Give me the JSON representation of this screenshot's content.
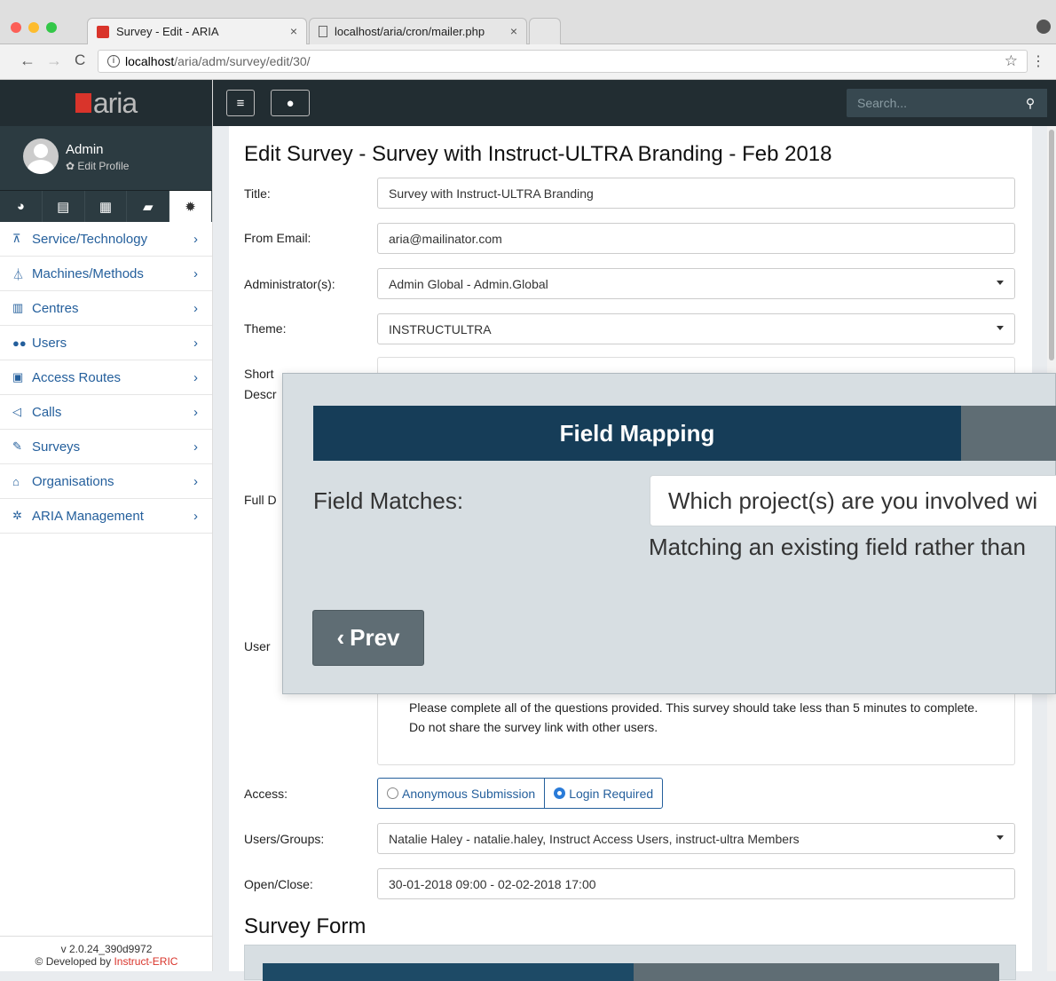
{
  "browser": {
    "tabs": [
      {
        "label": "Survey - Edit - ARIA"
      },
      {
        "label": "localhost/aria/cron/mailer.php"
      }
    ],
    "url_host": "localhost",
    "url_path": "/aria/adm/survey/edit/30/"
  },
  "app": {
    "logo": "aria",
    "user_name": "Admin",
    "edit_profile": "Edit Profile",
    "search_placeholder": "Search...",
    "version": "v 2.0.24_390d9972",
    "developed_by_prefix": "© Developed by ",
    "developed_by_link": "Instruct-ERIC"
  },
  "sidebar": {
    "items": [
      {
        "label": "Service/Technology",
        "icon": "sitemap-icon"
      },
      {
        "label": "Machines/Methods",
        "icon": "flask-icon"
      },
      {
        "label": "Centres",
        "icon": "building-icon"
      },
      {
        "label": "Users",
        "icon": "users-icon"
      },
      {
        "label": "Access Routes",
        "icon": "money-icon"
      },
      {
        "label": "Calls",
        "icon": "bullhorn-icon"
      },
      {
        "label": "Surveys",
        "icon": "edit-icon"
      },
      {
        "label": "Organisations",
        "icon": "institution-icon"
      },
      {
        "label": "ARIA Management",
        "icon": "cogs-icon"
      }
    ]
  },
  "page": {
    "title": "Edit Survey - Survey with Instruct-ULTRA Branding - Feb 2018",
    "labels": {
      "title": "Title:",
      "from_email": "From Email:",
      "administrators": "Administrator(s):",
      "theme": "Theme:",
      "short_desc_1": "Short",
      "short_desc_2": "Descr",
      "full_desc": "Full D",
      "user": "User",
      "access": "Access:",
      "users_groups": "Users/Groups:",
      "open_close": "Open/Close:"
    },
    "values": {
      "title": "Survey with Instruct-ULTRA Branding",
      "from_email": "aria@mailinator.com",
      "administrators": "Admin Global - Admin.Global",
      "theme": "INSTRUCTULTRA",
      "users_groups": "Natalie Haley - natalie.haley, Instruct Access Users, instruct-ultra Members",
      "open_close": "30-01-2018 09:00 - 02-02-2018 17:00"
    },
    "note": "Please complete all of the questions provided. This survey should take less than 5 minutes to complete. Do not share the survey link with other users.",
    "access_options": [
      "Anonymous Submission",
      "Login Required"
    ],
    "survey_form_heading": "Survey Form"
  },
  "overlay": {
    "header": "Field Mapping",
    "field_matches_label": "Field Matches:",
    "field_value": "Which project(s) are you involved wi",
    "help": "Matching an existing field rather than",
    "prev_button": "Prev"
  }
}
